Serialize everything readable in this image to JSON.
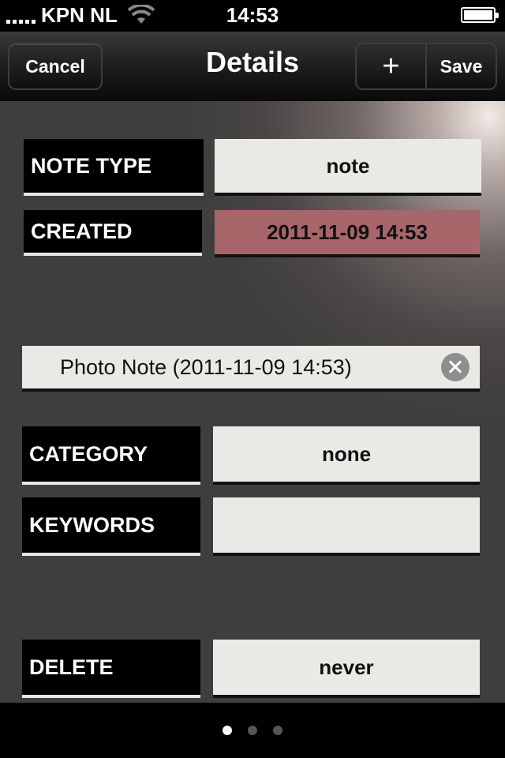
{
  "status_bar": {
    "carrier": "KPN NL",
    "time": "14:53",
    "signal_icon": "signal-bars-icon",
    "wifi_icon": "wifi-icon",
    "battery_icon": "battery-icon"
  },
  "nav": {
    "cancel_label": "Cancel",
    "title": "Details",
    "add_label": "+",
    "save_label": "Save"
  },
  "fields": {
    "note_type_label": "NOTE TYPE",
    "note_type_value": "note",
    "created_label": "CREATED",
    "created_value": "2011-11-09 14:53",
    "title_value": "Photo Note (2011-11-09 14:53)",
    "category_label": "CATEGORY",
    "category_value": "none",
    "keywords_label": "KEYWORDS",
    "keywords_value": "",
    "delete_label": "DELETE",
    "delete_value": "never"
  },
  "page_control": {
    "page_count": 3,
    "current_page": 1
  },
  "colors": {
    "created_highlight": "#a8656a",
    "field_bg": "#ebe9e6",
    "label_bg": "#000000"
  }
}
